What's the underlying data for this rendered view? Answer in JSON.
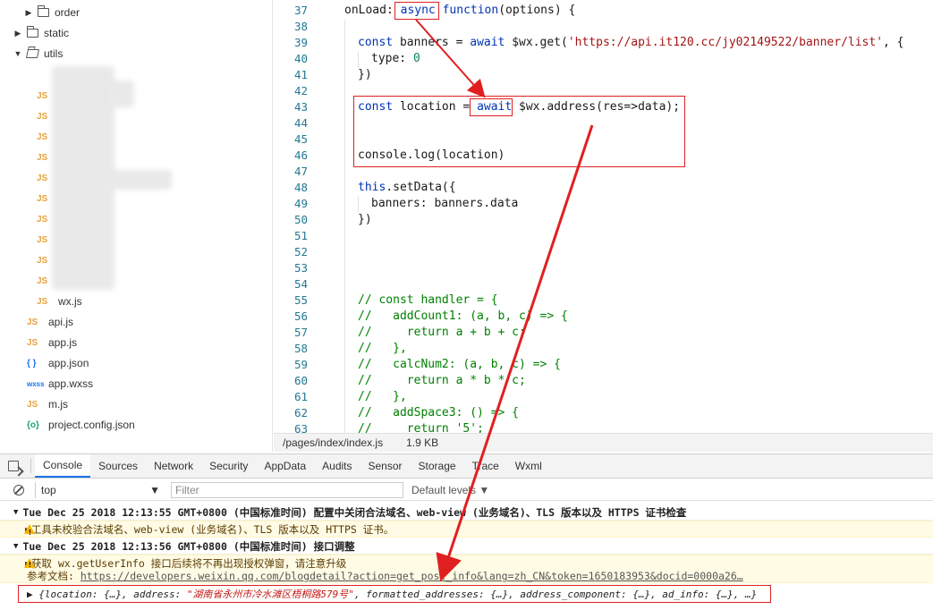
{
  "tree": {
    "items": [
      {
        "label": "order",
        "kind": "folder",
        "state": "collapsed"
      },
      {
        "label": "static",
        "kind": "folder",
        "state": "collapsed"
      },
      {
        "label": "utils",
        "kind": "folder",
        "state": "expanded"
      },
      {
        "label": "wx.js",
        "kind": "js"
      },
      {
        "label": "api.js",
        "kind": "js"
      },
      {
        "label": "app.js",
        "kind": "js"
      },
      {
        "label": "app.json",
        "kind": "json"
      },
      {
        "label": "app.wxss",
        "kind": "wxss"
      },
      {
        "label": "m.js",
        "kind": "js"
      },
      {
        "label": "project.config.json",
        "kind": "config"
      }
    ],
    "blurred_js_label": "JS",
    "icon_text": {
      "js": "JS",
      "json": "{ }",
      "wxss": "wxss",
      "config": "{o}"
    }
  },
  "editor": {
    "lines": [
      {
        "n": "37",
        "text": "onLoad: async function(options) {"
      },
      {
        "n": "38",
        "text": ""
      },
      {
        "n": "39",
        "text": "const banners = await $wx.get('https://api.it120.cc/jy02149522/banner/list', {"
      },
      {
        "n": "40",
        "text": "type: 0"
      },
      {
        "n": "41",
        "text": "})"
      },
      {
        "n": "42",
        "text": ""
      },
      {
        "n": "43",
        "text": "const location = await $wx.address(res=>data);"
      },
      {
        "n": "44",
        "text": ""
      },
      {
        "n": "45",
        "text": ""
      },
      {
        "n": "46",
        "text": "console.log(location)"
      },
      {
        "n": "47",
        "text": ""
      },
      {
        "n": "48",
        "text": "this.setData({"
      },
      {
        "n": "49",
        "text": "banners: banners.data"
      },
      {
        "n": "50",
        "text": "})"
      },
      {
        "n": "51",
        "text": ""
      },
      {
        "n": "52",
        "text": ""
      },
      {
        "n": "53",
        "text": ""
      },
      {
        "n": "54",
        "text": ""
      },
      {
        "n": "55",
        "text": "// const handler = {"
      },
      {
        "n": "56",
        "text": "//   addCount1: (a, b, c) => {"
      },
      {
        "n": "57",
        "text": "//     return a + b + c;"
      },
      {
        "n": "58",
        "text": "//   },"
      },
      {
        "n": "59",
        "text": "//   calcNum2: (a, b, c) => {"
      },
      {
        "n": "60",
        "text": "//     return a * b * c;"
      },
      {
        "n": "61",
        "text": "//   },"
      },
      {
        "n": "62",
        "text": "//   addSpace3: () => {"
      },
      {
        "n": "63",
        "text": "//     return '5';"
      }
    ]
  },
  "statusbar": {
    "path": "/pages/index/index.js",
    "size": "1.9 KB"
  },
  "devtools": {
    "tabs": [
      "Console",
      "Sources",
      "Network",
      "Security",
      "AppData",
      "Audits",
      "Sensor",
      "Storage",
      "Trace",
      "Wxml"
    ],
    "active_tab": "Console",
    "context": "top",
    "filter_placeholder": "Filter",
    "levels_label": "Default levels"
  },
  "console": {
    "group1": "Tue Dec 25 2018 12:13:55 GMT+0800 (中国标准时间) 配置中关闭合法域名、web-view (业务域名)、TLS 版本以及 HTTPS 证书检查",
    "warn1": "▶工具未校验合法域名、web-view (业务域名)、TLS 版本以及 HTTPS 证书。",
    "group2": "Tue Dec 25 2018 12:13:56 GMT+0800 (中国标准时间) 接口调整",
    "warn2_line1": "▶获取 wx.getUserInfo 接口后续将不再出现授权弹窗，请注意升级",
    "warn2_line2_label": "参考文档:",
    "warn2_link": "https://developers.weixin.qq.com/blogdetail?action=get_post_info&lang=zh_CN&token=1650183953&docid=0000a26…",
    "log_obj_prefix": "▶ {location: {…}, address: ",
    "log_obj_address": "\"湖南省永州市冷水滩区梧桐路579号\"",
    "log_obj_suffix": ", formatted_addresses: {…}, address_component: {…}, ad_info: {…}, …}"
  },
  "colors": {
    "annotation": "#e02020",
    "active_tab": "#1a73e8",
    "warning_bg": "#fffbe5"
  }
}
